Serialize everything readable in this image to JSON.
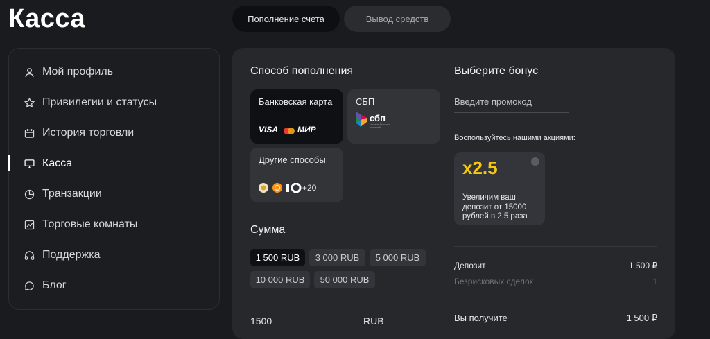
{
  "page": {
    "title": "Касса"
  },
  "tabs": [
    {
      "label": "Пополнение счета",
      "active": true
    },
    {
      "label": "Вывод средств",
      "active": false
    }
  ],
  "sidebar": {
    "items": [
      {
        "label": "Мой профиль",
        "icon": "user-icon"
      },
      {
        "label": "Привилегии и статусы",
        "icon": "star-icon"
      },
      {
        "label": "История торговли",
        "icon": "calendar-icon"
      },
      {
        "label": "Касса",
        "icon": "monitor-icon",
        "active": true
      },
      {
        "label": "Транзакции",
        "icon": "pie-chart-icon"
      },
      {
        "label": "Торговые комнаты",
        "icon": "chart-line-icon"
      },
      {
        "label": "Поддержка",
        "icon": "headphones-icon"
      },
      {
        "label": "Блог",
        "icon": "chat-bubble-icon"
      }
    ]
  },
  "payment": {
    "title": "Способ пополнения",
    "methods": [
      {
        "label": "Банковская карта",
        "logos": [
          "VISA",
          "МИР"
        ],
        "selected": true
      },
      {
        "label": "СБП",
        "logo_text": "сбп",
        "logo_subtext": "система быстрых платежей"
      },
      {
        "label": "Другие способы",
        "extra": "+20"
      }
    ]
  },
  "amount": {
    "title": "Сумма",
    "options": [
      "1 500 RUB",
      "3 000 RUB",
      "5 000 RUB",
      "10 000 RUB",
      "50 000 RUB"
    ],
    "selected_index": 0,
    "input_value": "1500",
    "currency": "RUB"
  },
  "bonus": {
    "title": "Выберите бонус",
    "promo_placeholder": "Введите промокод",
    "promo_heading": "Воспользуйтесь нашими акциями:",
    "card": {
      "multiplier": "x2.5",
      "description": "Увеличим ваш депозит от 15000 рублей в 2.5 раза"
    }
  },
  "summary": {
    "deposit_label": "Депозит",
    "deposit_value": "1 500 ₽",
    "riskfree_label": "Безрисковых сделок",
    "riskfree_value": "1",
    "receive_label": "Вы получите",
    "receive_value": "1 500 ₽"
  },
  "colors": {
    "background": "#1a1b1f",
    "panel": "#27282c",
    "accent_yellow": "#f5c90f",
    "selected": "#0f1013"
  }
}
